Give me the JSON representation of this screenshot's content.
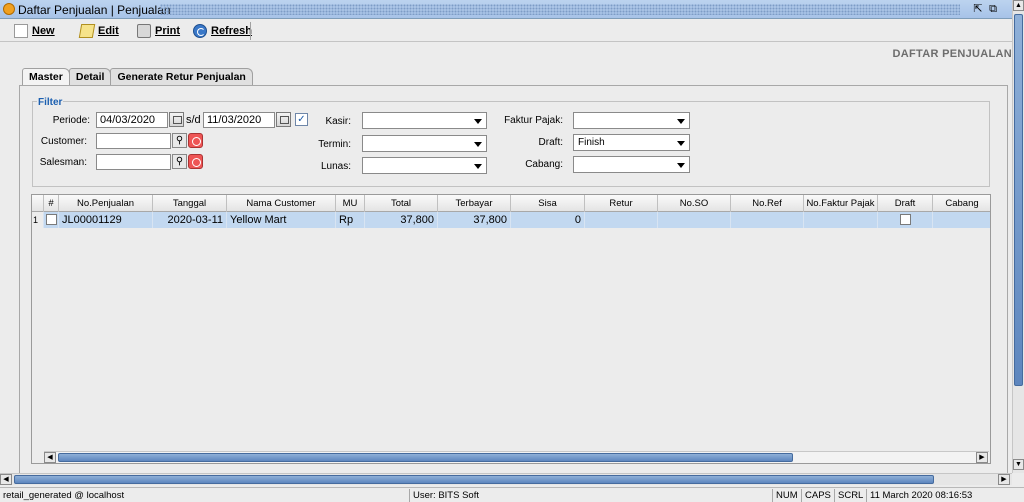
{
  "window": {
    "title": "Daftar Penjualan | Penjualan"
  },
  "toolbar": {
    "new_label": "New",
    "edit_label": "Edit",
    "print_label": "Print",
    "refresh_label": "Refresh"
  },
  "heading": "DAFTAR PENJUALAN",
  "tabs": [
    {
      "label": "Master"
    },
    {
      "label": "Detail"
    },
    {
      "label": "Generate Retur Penjualan"
    }
  ],
  "filter": {
    "legend": "Filter",
    "periode_label": "Periode:",
    "periode_from": "04/03/2020",
    "sd_label": "s/d",
    "periode_to": "11/03/2020",
    "periode_checked": true,
    "customer_label": "Customer:",
    "customer_value": "",
    "salesman_label": "Salesman:",
    "salesman_value": "",
    "kasir_label": "Kasir:",
    "kasir_value": "",
    "termin_label": "Termin:",
    "termin_value": "",
    "lunas_label": "Lunas:",
    "lunas_value": "",
    "faktur_pajak_label": "Faktur Pajak:",
    "faktur_pajak_value": "",
    "draft_label": "Draft:",
    "draft_value": "Finish",
    "cabang_label": "Cabang:",
    "cabang_value": ""
  },
  "table": {
    "columns": [
      "#",
      "No.Penjualan",
      "Tanggal",
      "Nama Customer",
      "MU",
      "Total",
      "Terbayar",
      "Sisa",
      "Retur",
      "No.SO",
      "No.Ref",
      "No.Faktur Pajak",
      "Draft",
      "Cabang"
    ],
    "rows": [
      {
        "row_num": "1",
        "no_penjualan": "JL00001129",
        "tanggal": "2020-03-11",
        "nama_customer": "Yellow Mart",
        "mu": "Rp",
        "total": "37,800",
        "terbayar": "37,800",
        "sisa": "0",
        "retur": "",
        "no_so": "",
        "no_ref": "",
        "no_faktur_pajak": "",
        "draft": false,
        "cabang": ""
      }
    ]
  },
  "statusbar": {
    "connection": "retail_generated @ localhost",
    "user": "User: BITS Soft",
    "num": "NUM",
    "caps": "CAPS",
    "scrl": "SCRL",
    "datetime": "11 March 2020  08:16:53"
  },
  "colors": {
    "selected_row": "#c2d8f0",
    "legend": "#1b5fb0",
    "titlebar": "#bcd3ef"
  }
}
